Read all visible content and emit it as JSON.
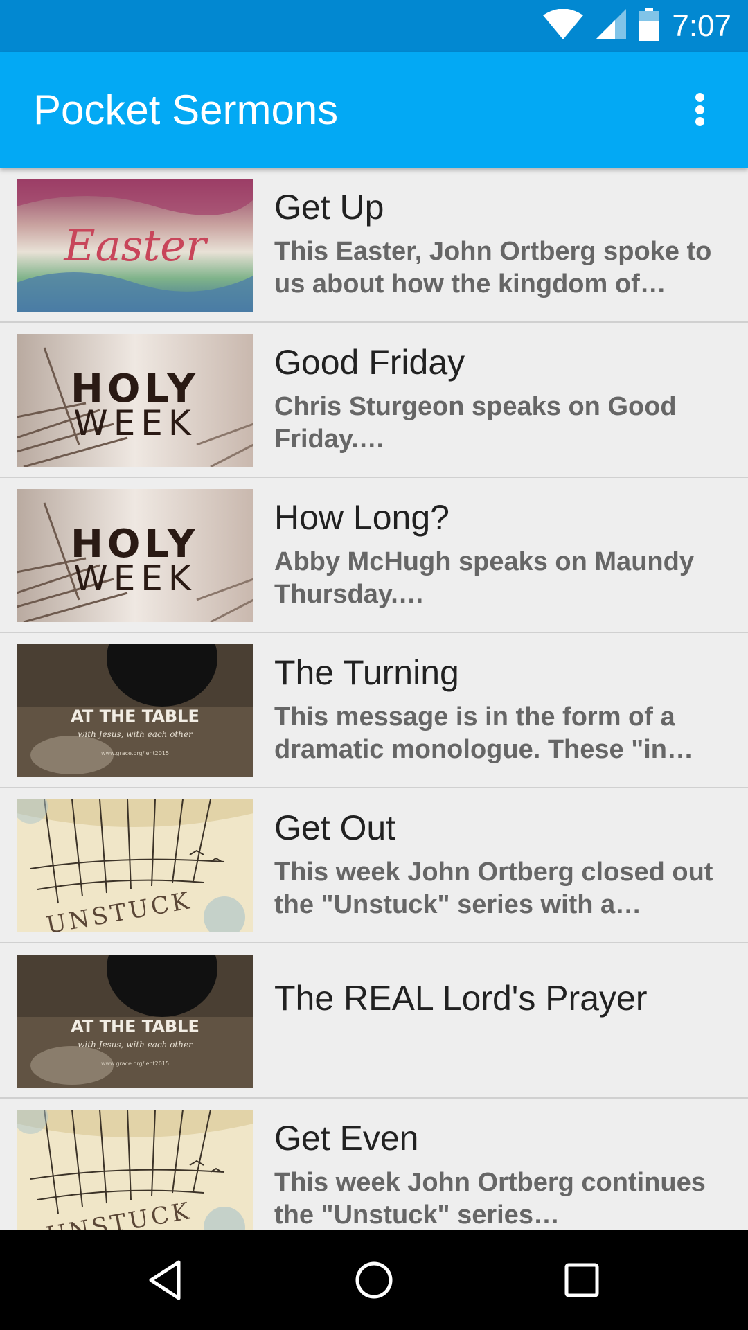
{
  "status_bar": {
    "time": "7:07",
    "icons": [
      "wifi-icon",
      "cell-signal-icon",
      "battery-icon"
    ]
  },
  "app_bar": {
    "title": "Pocket Sermons",
    "overflow_icon": "more-vert-icon"
  },
  "colors": {
    "status_bar": "#0288d1",
    "app_bar": "#03a9f4",
    "list_background": "#eeeeee",
    "title_text": "#212121",
    "description_text": "#666666"
  },
  "sermons": [
    {
      "title": "Get Up",
      "description": "This Easter, John Ortberg spoke to us about how the kingdom of…",
      "thumbnail": "Easter"
    },
    {
      "title": "Good Friday",
      "description": "Chris Sturgeon speaks on Good Friday.…",
      "thumbnail": "HOLY WEEK"
    },
    {
      "title": "How Long?",
      "description": "Abby McHugh speaks on Maundy Thursday.…",
      "thumbnail": "HOLY WEEK"
    },
    {
      "title": "The Turning",
      "description": "This message is in the form of a dramatic monologue. These \"in…",
      "thumbnail": "AT THE TABLE"
    },
    {
      "title": "Get Out",
      "description": "This week John Ortberg closed out the \"Unstuck\" series with a…",
      "thumbnail": "UNSTUCK"
    },
    {
      "title": "The REAL Lord's Prayer",
      "description": "",
      "thumbnail": "AT THE TABLE"
    },
    {
      "title": "Get Even",
      "description": "This week John Ortberg continues the \"Unstuck\" series…",
      "thumbnail": "UNSTUCK"
    }
  ],
  "thumbnail_text": {
    "easter": "Easter",
    "holy": "HOLY",
    "week": "WEEK",
    "at_the_table": "AT THE TABLE",
    "at_the_table_sub": "with Jesus, with each other",
    "at_the_table_url": "www.grace.org/lent2015",
    "unstuck": "UNSTUCK"
  },
  "nav_bar": {
    "buttons": [
      "back-icon",
      "home-icon",
      "recents-icon"
    ]
  }
}
